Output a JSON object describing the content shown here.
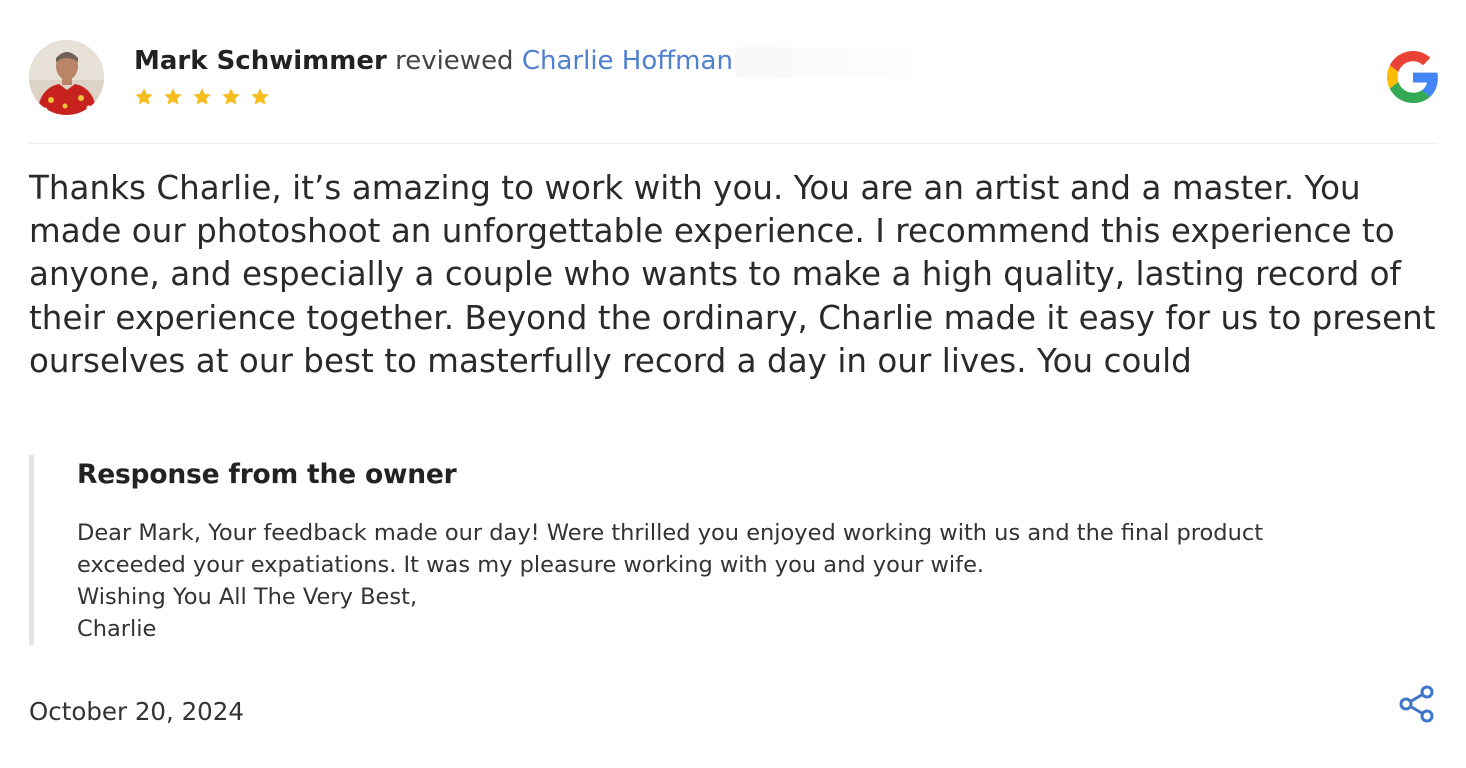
{
  "review": {
    "reviewer_name": "Mark Schwimmer",
    "reviewed_word": "reviewed",
    "business_name": "Charlie Hoffman",
    "rating": 5,
    "max_rating": 5,
    "body": "Thanks Charlie, it’s amazing to work with you. You are an artist and a master. You made our photoshoot an unforgettable experience. I recommend this experience to anyone, and especially a couple who wants to make a high quality, lasting record of their experience together. Beyond the ordinary, Charlie made it easy for us to present ourselves at our best to masterfully record a day in our lives. You could",
    "date": "October 20, 2024",
    "source_icon": "google-icon"
  },
  "owner_response": {
    "title": "Response from the owner",
    "text": "Dear Mark, Your feedback made our day! Were thrilled you enjoyed working with us and the final product exceeded your expatiations. It was my pleasure working with you and your wife.\nWishing You All The Very Best,\nCharlie"
  },
  "colors": {
    "star": "#f5bd1d",
    "link": "#4f7fd0",
    "share_icon": "#3f76cd",
    "response_border": "#e4e4e4"
  },
  "icons": {
    "share": "share-icon",
    "avatar": "avatar"
  }
}
